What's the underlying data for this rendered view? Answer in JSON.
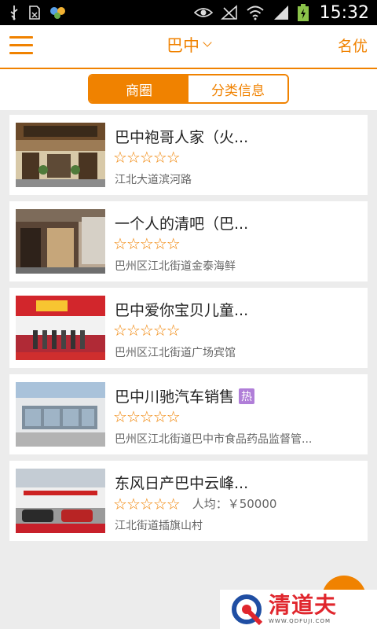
{
  "status_bar": {
    "time": "15:32",
    "icons": [
      "usb-icon",
      "sd-card-icon",
      "app-icon",
      "eye-icon",
      "no-signal-icon",
      "wifi-icon",
      "signal-icon",
      "battery-charging-icon"
    ]
  },
  "header": {
    "city": "巴中",
    "right_link": "名优"
  },
  "tabs": [
    {
      "label": "商圈",
      "active": true
    },
    {
      "label": "分类信息",
      "active": false
    }
  ],
  "listings": [
    {
      "title": "巴中袍哥人家（火...",
      "rating": 5,
      "address": "江北大道滨河路",
      "hot": false,
      "avg_label": ""
    },
    {
      "title": "一个人的清吧（巴...",
      "rating": 5,
      "address": "巴州区江北街道金泰海鲜",
      "hot": false,
      "avg_label": ""
    },
    {
      "title": "巴中爱你宝贝儿童...",
      "rating": 5,
      "address": "巴州区江北街道广场宾馆",
      "hot": false,
      "avg_label": ""
    },
    {
      "title": "巴中川驰汽车销售",
      "rating": 5,
      "address": "巴州区江北街道巴中市食品药品监督管...",
      "hot": true,
      "hot_label": "热",
      "avg_label": ""
    },
    {
      "title": "东风日产巴中云峰...",
      "rating": 5,
      "address": "江北街道插旗山村",
      "hot": false,
      "avg_label": "人均：￥50000"
    }
  ],
  "watermark": {
    "name": "清道夫",
    "url": "WWW.QDFUJI.COM"
  },
  "colors": {
    "accent": "#f08200",
    "background": "#ececec"
  }
}
